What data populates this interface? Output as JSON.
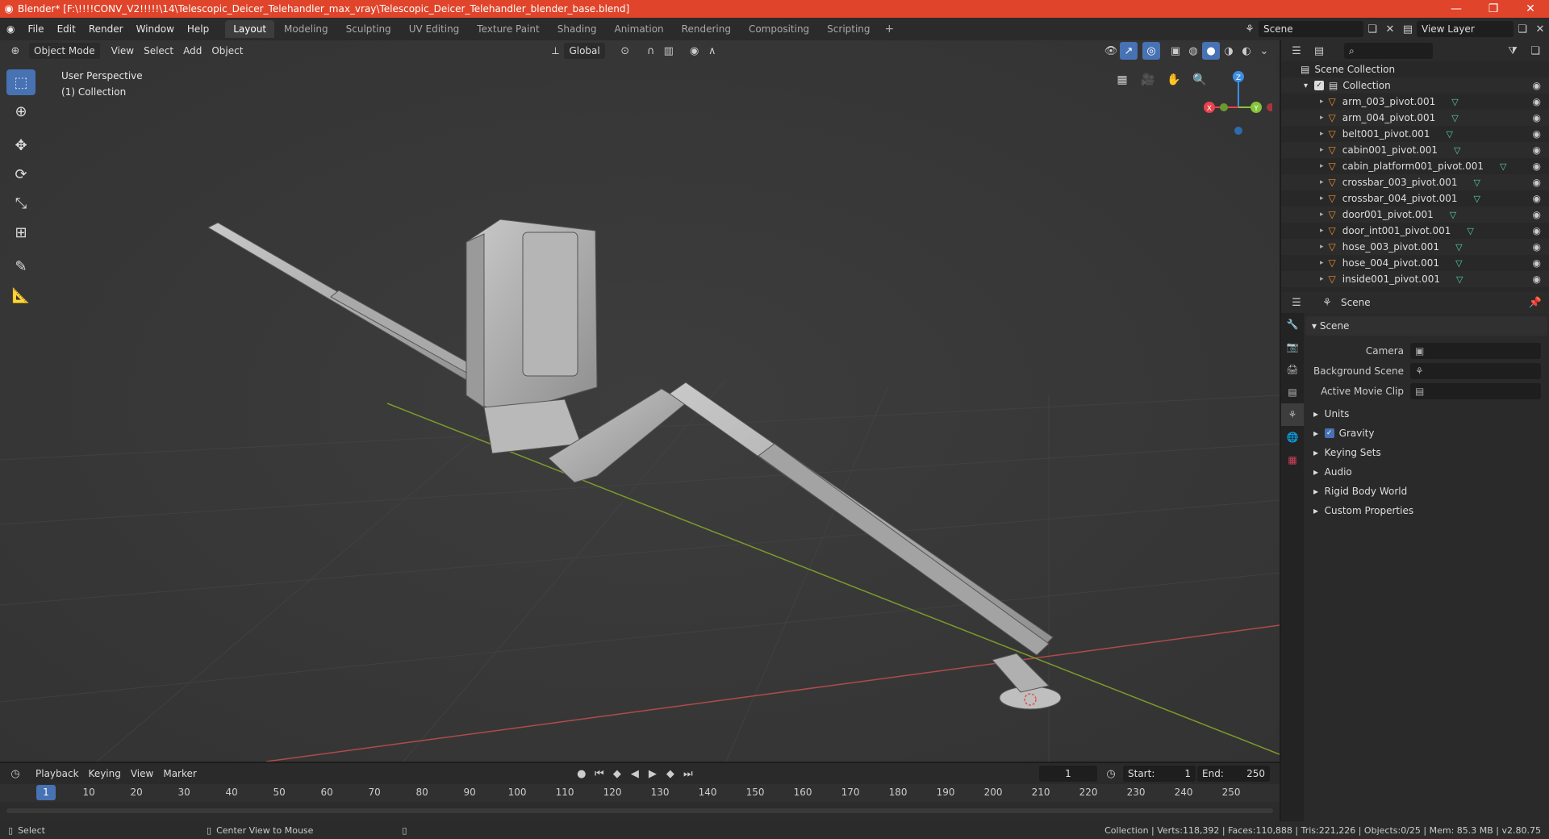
{
  "window": {
    "title": "Blender* [F:\\!!!!CONV_V2!!!!!\\14\\Telescopic_Deicer_Telehandler_max_vray\\Telescopic_Deicer_Telehandler_blender_base.blend]",
    "controls": [
      "—",
      "❐",
      "✕"
    ]
  },
  "menus": [
    "File",
    "Edit",
    "Render",
    "Window",
    "Help"
  ],
  "workspaces": [
    "Layout",
    "Modeling",
    "Sculpting",
    "UV Editing",
    "Texture Paint",
    "Shading",
    "Animation",
    "Rendering",
    "Compositing",
    "Scripting"
  ],
  "active_workspace": "Layout",
  "scene_selector": "Scene",
  "view_layer_selector": "View Layer",
  "viewport": {
    "mode": "Object Mode",
    "menu": [
      "View",
      "Select",
      "Add",
      "Object"
    ],
    "transform_orientation": "Global",
    "overlay_info": [
      "User Perspective",
      "(1) Collection"
    ],
    "gizmo_axes": {
      "x": "X",
      "y": "Y",
      "z": "Z"
    },
    "colors": {
      "x": "#e8424c",
      "y": "#86c43a",
      "z": "#3c8ee6",
      "grid_x": "#b04b4b",
      "grid_y": "#7c9b2a"
    }
  },
  "outliner": {
    "root": "Scene Collection",
    "collection": "Collection",
    "items": [
      "arm_003_pivot.001",
      "arm_004_pivot.001",
      "belt001_pivot.001",
      "cabin001_pivot.001",
      "cabin_platform001_pivot.001",
      "crossbar_003_pivot.001",
      "crossbar_004_pivot.001",
      "door001_pivot.001",
      "door_int001_pivot.001",
      "hose_003_pivot.001",
      "hose_004_pivot.001",
      "inside001_pivot.001"
    ]
  },
  "properties": {
    "context": "Scene",
    "panel_title": "Scene",
    "fields": [
      {
        "label": "Camera"
      },
      {
        "label": "Background Scene"
      },
      {
        "label": "Active Movie Clip"
      }
    ],
    "subpanels": [
      "Units",
      "Gravity",
      "Keying Sets",
      "Audio",
      "Rigid Body World",
      "Custom Properties"
    ],
    "gravity_checked": true
  },
  "timeline": {
    "menu": [
      "Playback",
      "Keying",
      "View",
      "Marker"
    ],
    "current_frame": "1",
    "start_label": "Start:",
    "start": "1",
    "end_label": "End:",
    "end": "250",
    "ticks": [
      "1",
      "10",
      "20",
      "30",
      "40",
      "50",
      "60",
      "70",
      "80",
      "90",
      "100",
      "110",
      "120",
      "130",
      "140",
      "150",
      "160",
      "170",
      "180",
      "190",
      "200",
      "210",
      "220",
      "230",
      "240",
      "250"
    ]
  },
  "statusbar": {
    "left": "Select",
    "middle": "Center View to Mouse",
    "right": "Collection | Verts:118,392 | Faces:110,888 | Tris:221,226 | Objects:0/25 | Mem: 85.3 MB | v2.80.75"
  }
}
